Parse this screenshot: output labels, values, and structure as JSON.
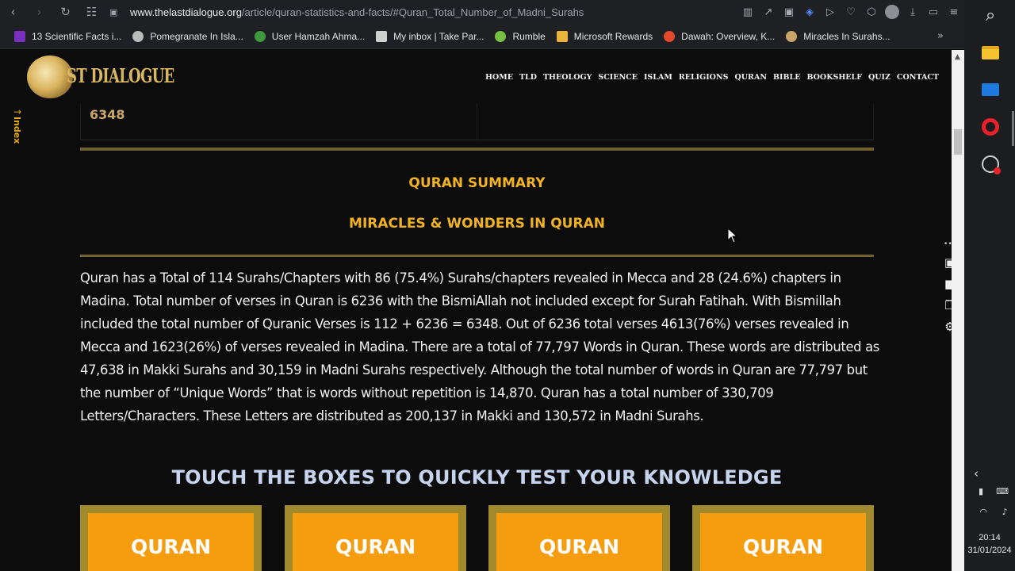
{
  "browser": {
    "url_host": "www.thelastdialogue.org",
    "url_path": "/article/quran-statistics-and-facts/#Quran_Total_Number_of_Madni_Surahs"
  },
  "bookmarks": [
    {
      "label": "13 Scientific Facts i...",
      "color": "#7b2fbe"
    },
    {
      "label": "Pomegranate In Isla...",
      "color": "#bbbbbb"
    },
    {
      "label": "User Hamzah Ahma...",
      "color": "#3c9a3c"
    },
    {
      "label": "My inbox | Take Par...",
      "color": "#d0d0d0"
    },
    {
      "label": "Rumble",
      "color": "#75c043"
    },
    {
      "label": "Microsoft Rewards",
      "color": "#e8b33a"
    },
    {
      "label": "Dawah: Overview, K...",
      "color": "#e24a2b"
    },
    {
      "label": "Miracles In Surahs...",
      "color": "#c9a567"
    }
  ],
  "site": {
    "logo_text": "ST DIALOGUE",
    "menu": [
      "HOME",
      "TLD",
      "THEOLOGY",
      "SCIENCE",
      "ISLAM",
      "RELIGIONS",
      "QURAN",
      "BIBLE",
      "BOOKSHELF",
      "QUIZ",
      "CONTACT"
    ],
    "index_label": "Index"
  },
  "content": {
    "stat_value": "6348",
    "summary_title": "QURAN SUMMARY",
    "summary_subtitle": "MIRACLES & WONDERS IN QURAN",
    "paragraph": "Quran has a Total of 114 Surahs/Chapters with 86 (75.4%) Surahs/chapters revealed in Mecca and 28 (24.6%) chapters in Madina. Total number of verses in Quran is 6236 with the BismiAllah not included except for Surah Fatihah. With Bismillah included the total number of Quranic Verses is 112 + 6236 = 6348. Out of 6236 total verses 4613(76%) verses revealed in Mecca and 1623(26%) of verses revealed in Madina. There are a total of 77,797 Words in Quran. These words are distributed as 47,638 in Makki Surahs and 30,159 in Madni Surahs respectively. Although the total number of words in Quran are 77,797 but the number of “Unique Words” that is words without repetition is 14,870. Quran has a total number of 330,709 Letters/Characters. These Letters are distributed as 200,137 in Makki and 130,572 in Madni Surahs.",
    "knowledge_heading": "TOUCH THE BOXES TO QUICKLY TEST YOUR KNOWLEDGE",
    "boxes": [
      "QURAN",
      "QURAN",
      "QURAN",
      "QURAN"
    ]
  },
  "taskbar": {
    "time": "20:14",
    "date": "31/01/2024"
  },
  "colors": {
    "accent_gold": "#f2b321",
    "box_orange": "#f59d0e",
    "rule_olive": "#6e6030"
  }
}
